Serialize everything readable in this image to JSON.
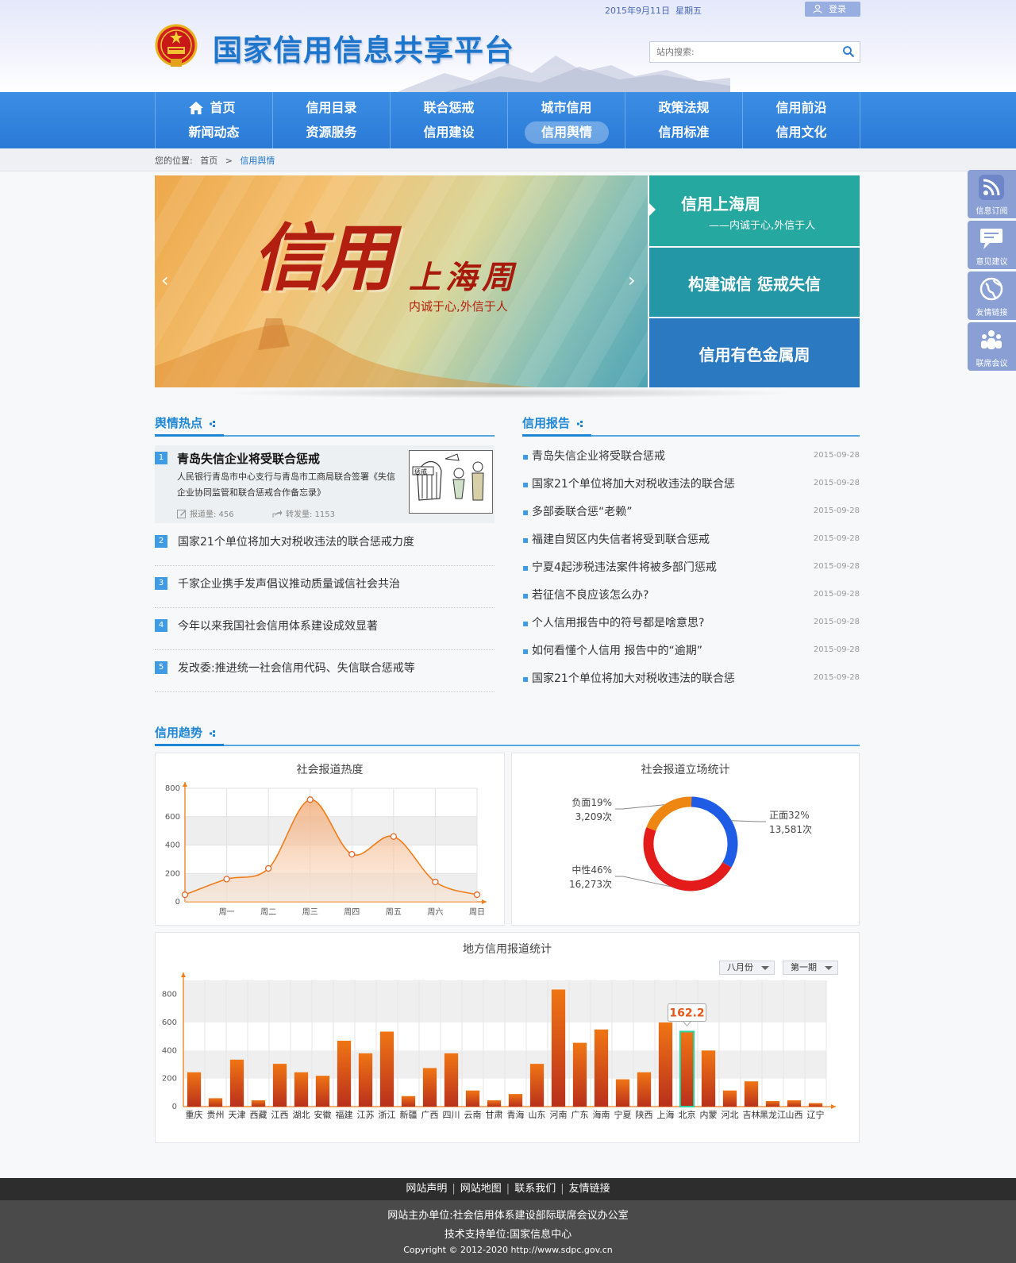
{
  "header": {
    "date": "2015年9月11日",
    "weekday": "星期五",
    "login": "登录",
    "title": "国家信用信息共享平台",
    "search_placeholder": "站内搜索:"
  },
  "nav": [
    {
      "top": "首页",
      "bottom": "新闻动态"
    },
    {
      "top": "信用目录",
      "bottom": "资源服务"
    },
    {
      "top": "联合惩戒",
      "bottom": "信用建设"
    },
    {
      "top": "城市信用",
      "bottom": "信用舆情"
    },
    {
      "top": "政策法规",
      "bottom": "信用标准"
    },
    {
      "top": "信用前沿",
      "bottom": "信用文化"
    }
  ],
  "breadcrumb": {
    "label": "您的位置:",
    "home": "首页",
    "current": "信用舆情"
  },
  "banner": {
    "big": "信用",
    "mid": "上海周",
    "sub": "内诚于心,外信于人"
  },
  "banner_tabs": [
    {
      "title": "信用上海周",
      "sub": "——内诚于心,外信于人"
    },
    {
      "title": "构建诚信  惩戒失信"
    },
    {
      "title": "信用有色金属周"
    }
  ],
  "float_tabs": [
    {
      "label": "信息订阅",
      "icon": "rss-icon"
    },
    {
      "label": "意见建议",
      "icon": "chat-icon"
    },
    {
      "label": "友情链接",
      "icon": "globe-icon"
    },
    {
      "label": "联席会议",
      "icon": "people-icon"
    }
  ],
  "hot": {
    "heading": "舆情热点",
    "first": {
      "num": "1",
      "title": "青岛失信企业将受联合惩戒",
      "desc": "人民银行青岛市中心支行与青岛市工商局联合签署《失信企业协同监管和联合惩戒合作备忘录》",
      "reports": "报道量: 456",
      "shares": "转发量: 1153",
      "thumb_text": "惩戒"
    },
    "items": [
      {
        "num": "2",
        "title": "国家21个单位将加大对税收违法的联合惩戒力度"
      },
      {
        "num": "3",
        "title": "千家企业携手发声倡议推动质量诚信社会共治"
      },
      {
        "num": "4",
        "title": "今年以来我国社会信用体系建设成效显著"
      },
      {
        "num": "5",
        "title": "发改委:推进统一社会信用代码、失信联合惩戒等"
      }
    ]
  },
  "report": {
    "heading": "信用报告",
    "items": [
      {
        "title": "青岛失信企业将受联合惩戒",
        "date": "2015-09-28"
      },
      {
        "title": "国家21个单位将加大对税收违法的联合惩",
        "date": "2015-09-28"
      },
      {
        "title": "多部委联合惩“老赖”",
        "date": "2015-09-28"
      },
      {
        "title": "福建自贸区内失信者将受到联合惩戒",
        "date": "2015-09-28"
      },
      {
        "title": "宁夏4起涉税违法案件将被多部门惩戒",
        "date": "2015-09-28"
      },
      {
        "title": "若征信不良应该怎么办?",
        "date": "2015-09-28"
      },
      {
        "title": "个人信用报告中的符号都是啥意思?",
        "date": "2015-09-28"
      },
      {
        "title": "如何看懂个人信用 报告中的“逾期”",
        "date": "2015-09-28"
      },
      {
        "title": "国家21个单位将加大对税收违法的联合惩",
        "date": "2015-09-28"
      }
    ]
  },
  "trend": {
    "heading": "信用趋势"
  },
  "chart_data": [
    {
      "type": "area",
      "title": "社会报道热度",
      "x": [
        "",
        "周一",
        "周二",
        "周三",
        "周四",
        "周五",
        "周六",
        "周日"
      ],
      "values": [
        50,
        160,
        235,
        720,
        335,
        460,
        140,
        50
      ],
      "ylim": [
        0,
        800
      ],
      "yticks": [
        0,
        200,
        400,
        600,
        800
      ],
      "grid": true
    },
    {
      "type": "pie",
      "title": "社会报道立场统计",
      "slices": [
        {
          "name": "正面",
          "percent": "32%",
          "count": "13,581次",
          "value": 32,
          "color": "#1f5ce6"
        },
        {
          "name": "中性",
          "percent": "46%",
          "count": "16,273次",
          "value": 46,
          "color": "#e41b1b"
        },
        {
          "name": "负面",
          "percent": "19%",
          "count": "3,209次",
          "value": 19,
          "color": "#ee8712"
        }
      ]
    },
    {
      "type": "bar",
      "title": "地方信用报道统计",
      "filters": {
        "month": "八月份",
        "period": "第一期"
      },
      "categories": [
        "重庆",
        "贵州",
        "天津",
        "西藏",
        "江西",
        "湖北",
        "安徽",
        "福建",
        "江苏",
        "浙江",
        "新疆",
        "广西",
        "四川",
        "云南",
        "甘肃",
        "青海",
        "山东",
        "河南",
        "广东",
        "海南",
        "宁夏",
        "陕西",
        "上海",
        "北京",
        "内蒙",
        "河北",
        "吉林",
        "黑龙江",
        "山西",
        "辽宁"
      ],
      "values": [
        245,
        60,
        335,
        45,
        305,
        245,
        220,
        470,
        380,
        535,
        75,
        275,
        380,
        115,
        45,
        90,
        305,
        835,
        455,
        550,
        195,
        245,
        600,
        535,
        400,
        115,
        180,
        40,
        45,
        25
      ],
      "highlight_index": 23,
      "highlight_label": "162.2",
      "ylim": [
        0,
        900
      ],
      "yticks": [
        0,
        200,
        400,
        600,
        800
      ],
      "grid": true
    }
  ],
  "footer": {
    "links": [
      "网站声明",
      "网站地图",
      "联系我们",
      "友情链接"
    ],
    "host": "网站主办单位:社会信用体系建设部际联席会议办公室",
    "tech": "技术支持单位:国家信息中心",
    "copyright": "Copyright © 2012-2020 http://www.sdpc.gov.cn"
  },
  "colors": {
    "primary": "#2a7ad6",
    "accent": "#1f86d3",
    "line": "#f07d1a",
    "bar": "#e2520e",
    "highlight": "#2fd1a2"
  }
}
